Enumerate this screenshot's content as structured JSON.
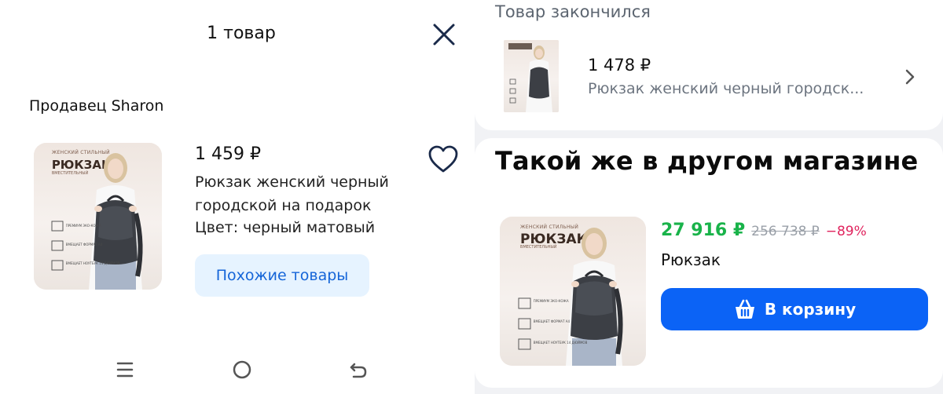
{
  "left_panel": {
    "title": "1 товар",
    "seller": "Продавец Sharon",
    "product": {
      "price": "1 459 ₽",
      "name": "Рюкзак женский черный городской на подарок",
      "color": "Цвет: черный матовый",
      "image": {
        "small_header": "ЖЕНСКИЙ СТИЛЬНЫЙ",
        "big_header": "РЮКЗАК",
        "sub_header": "ВМЕСТИТЕЛЬНЫЙ",
        "features": [
          "ПРЕМИУМ ЭКО-КОЖА",
          "ВМЕЩАЕТ ФОРМАТ А4",
          "ВМЕЩАЕТ НОУТБУК 14 ДЮЙМОВ"
        ]
      }
    },
    "similar_button": "Похожие товары",
    "icons": {
      "close": "close-icon",
      "heart": "heart-icon",
      "nav_menu": "menu-icon",
      "nav_home": "home-circle-icon",
      "nav_back": "back-icon"
    }
  },
  "right_panel": {
    "out_of_stock_label": "Товар закончился",
    "out_of_stock_product": {
      "price": "1 478 ₽",
      "name": "Рюкзак женский черный городск..."
    },
    "same_in_other_store_title": "Такой же в другом магазине",
    "offer": {
      "price_new": "27 916 ₽",
      "price_old": "256 738 ₽",
      "discount": "−89%",
      "name": "Рюкзак",
      "cart_button": "В корзину"
    },
    "icons": {
      "chevron": "chevron-right-icon",
      "cart": "basket-icon"
    }
  },
  "colors": {
    "accent_blue": "#0b63f6",
    "similar_bg": "#e6f3ff",
    "similar_text": "#1565d8",
    "price_green": "#19b34a",
    "discount_pink": "#e0245e",
    "muted_gray": "#9aa0a8",
    "panel_bg": "#f1f2f5"
  }
}
